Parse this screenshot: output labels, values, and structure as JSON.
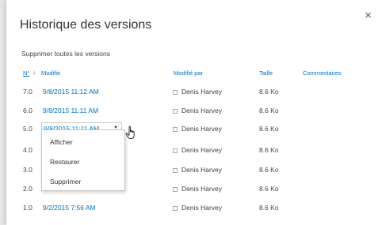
{
  "dialog": {
    "title": "Historique des versions",
    "close_label": "×",
    "delete_all_label": "Supprimer toutes les versions"
  },
  "columns": {
    "number": "N°",
    "sort_arrow": "↓",
    "modified": "Modifié",
    "modified_by": "Modifié par",
    "size": "Taille",
    "comments": "Commentaires"
  },
  "rows": [
    {
      "version": "7.0",
      "date": "9/8/2015 11:12 AM",
      "author": "Denis Harvey",
      "size": "8.6 Ko"
    },
    {
      "version": "6.0",
      "date": "9/8/2015 11:11 AM",
      "author": "Denis Harvey",
      "size": "8.6 Ko"
    },
    {
      "version": "5.0",
      "date": "9/8/2015 11:11 AM",
      "author": "Denis Harvey",
      "size": "8.6 Ko"
    },
    {
      "version": "4.0",
      "date": "",
      "author": "Denis Harvey",
      "size": "8.6 Ko"
    },
    {
      "version": "3.0",
      "date": "",
      "author": "Denis Harvey",
      "size": "8.6 Ko"
    },
    {
      "version": "2.0",
      "date": "",
      "author": "Denis Harvey",
      "size": "8.6 Ko"
    },
    {
      "version": "1.0",
      "date": "9/2/2015 7:56 AM",
      "author": "Denis Harvey",
      "size": "8.6 Ko"
    }
  ],
  "context_menu": {
    "caret": "▼",
    "items": [
      "Afficher",
      "Restaurer",
      "Supprimer"
    ]
  },
  "colors": {
    "link": "#0072c6",
    "text": "#444444"
  }
}
